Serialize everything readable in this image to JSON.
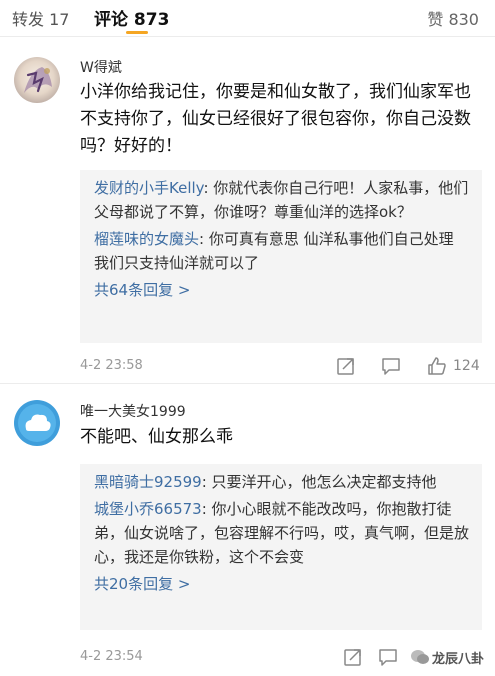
{
  "tabs": {
    "repost": "转发 17",
    "comment": "评论 873",
    "like": "赞 830"
  },
  "comments": [
    {
      "username": "W得斌",
      "text": "小洋你给我记住，你要是和仙女散了，我们仙家军也不支持你了，仙女已经很好了很包容你，你自己没数吗？好好的！",
      "replies": [
        {
          "name": "发财的小手Kelly",
          "text": ": 你就代表你自己行吧！人家私事，他们父母都说了不算，你谁呀？尊重仙洋的选择ok？"
        },
        {
          "name": "榴莲味的女魔头",
          "text": ": 你可真有意思 仙洋私事他们自己处理 我们只支持仙洋就可以了"
        }
      ],
      "more": "共64条回复 >",
      "time": "4-2 23:58",
      "likes": "124"
    },
    {
      "username": "唯一大美女1999",
      "text": "不能吧、仙女那么乖",
      "replies": [
        {
          "name": "黑暗骑士92599",
          "text": ": 只要洋开心，他怎么决定都支持他"
        },
        {
          "name": "城堡小乔66573",
          "text": ": 你小心眼就不能改改吗，你抱散打徒弟，仙女说啥了，包容理解不行吗，哎，真气啊，但是放心，我还是你铁粉，这个不会变"
        }
      ],
      "more": "共20条回复 >",
      "time": "4-2 23:54",
      "likes": ""
    }
  ],
  "watermark": "龙辰八卦"
}
